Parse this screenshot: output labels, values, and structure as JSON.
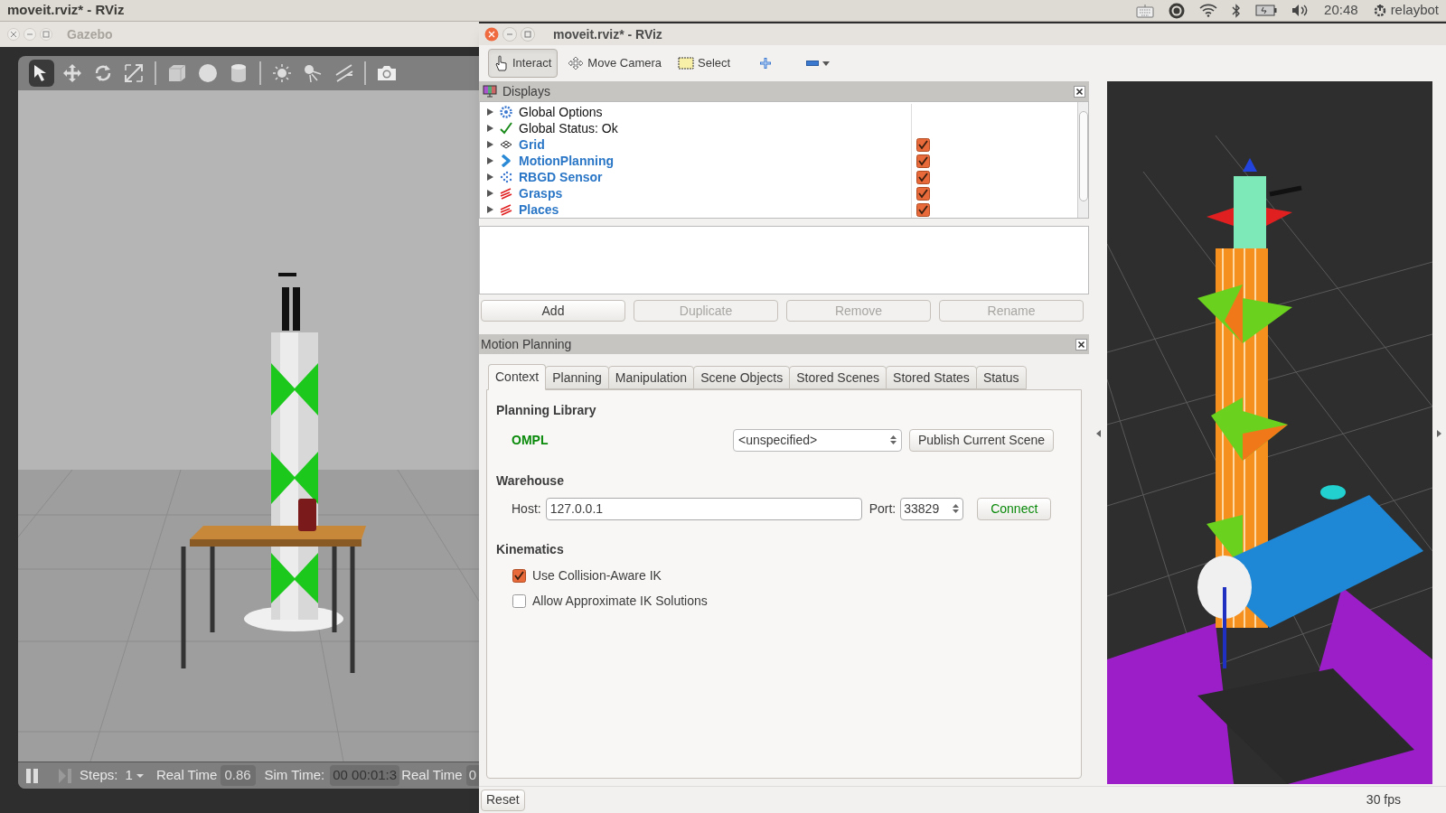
{
  "top_bar": {
    "title": "moveit.rviz* - RViz",
    "clock": "20:48",
    "user": "relaybot"
  },
  "gazebo": {
    "title": "Gazebo",
    "tool_groups": [
      [
        {
          "kind": "select",
          "selected": true
        },
        {
          "kind": "translate",
          "selected": false
        },
        {
          "kind": "rotate",
          "selected": false
        },
        {
          "kind": "scale",
          "selected": false
        }
      ],
      [
        {
          "kind": "box",
          "selected": false
        },
        {
          "kind": "sphere",
          "selected": false
        },
        {
          "kind": "cylinder",
          "selected": false
        }
      ],
      [
        {
          "kind": "point-light",
          "selected": false
        },
        {
          "kind": "spot-light",
          "selected": false
        },
        {
          "kind": "directional-light",
          "selected": false
        }
      ],
      [
        {
          "kind": "camera",
          "selected": false
        }
      ]
    ],
    "status_bar": {
      "steps_label": "Steps:",
      "steps": "1",
      "real_time_label": "Real Time",
      "real_time": "0.86",
      "sim_time_label": "Sim Time:",
      "sim_time": "00 00:01:3",
      "overlap_label": "Real Time",
      "overlap_value": "0"
    }
  },
  "rviz": {
    "title": "moveit.rviz* - RViz",
    "toolbar": [
      {
        "kind": "interact",
        "label": "Interact",
        "selected": true
      },
      {
        "kind": "move-camera",
        "label": "Move Camera",
        "selected": false
      },
      {
        "kind": "select",
        "label": "Select",
        "selected": false
      },
      {
        "kind": "add",
        "selected": false
      },
      {
        "kind": "remove",
        "selected": false
      }
    ],
    "displays": {
      "title": "Displays",
      "items": [
        {
          "kind": "options",
          "label": "Global Options"
        },
        {
          "kind": "status",
          "label": "Global Status: Ok"
        },
        {
          "kind": "grid",
          "label": "Grid",
          "checked": true
        },
        {
          "kind": "motion",
          "label": "MotionPlanning",
          "checked": true
        },
        {
          "kind": "sensor",
          "label": "RBGD Sensor",
          "checked": true
        },
        {
          "kind": "grasps",
          "label": "Grasps",
          "checked": true
        },
        {
          "kind": "grasps",
          "label": "Places",
          "checked": true
        }
      ],
      "buttons": [
        {
          "label": "Add",
          "disabled": false
        },
        {
          "label": "Duplicate",
          "disabled": true
        },
        {
          "label": "Remove",
          "disabled": true
        },
        {
          "label": "Rename",
          "disabled": true
        }
      ]
    },
    "motion_planning": {
      "title": "Motion Planning",
      "tabs": [
        {
          "label": "Context",
          "selected": true
        },
        {
          "label": "Planning",
          "selected": false
        },
        {
          "label": "Manipulation",
          "selected": false
        },
        {
          "label": "Scene Objects",
          "selected": false
        },
        {
          "label": "Stored Scenes",
          "selected": false
        },
        {
          "label": "Stored States",
          "selected": false
        },
        {
          "label": "Status",
          "selected": false
        }
      ],
      "planning_library": {
        "heading": "Planning Library",
        "library": "OMPL",
        "planner": "<unspecified>",
        "publish_button": "Publish Current Scene"
      },
      "warehouse": {
        "heading": "Warehouse",
        "host_label": "Host:",
        "host": "127.0.0.1",
        "port_label": "Port:",
        "port": "33829",
        "connect_button": "Connect"
      },
      "kinematics": {
        "heading": "Kinematics",
        "options": [
          {
            "label": "Use Collision-Aware IK",
            "checked": true
          },
          {
            "label": "Allow Approximate IK Solutions",
            "checked": false
          }
        ]
      }
    },
    "reset_button": "Reset",
    "fps": "30 fps"
  }
}
